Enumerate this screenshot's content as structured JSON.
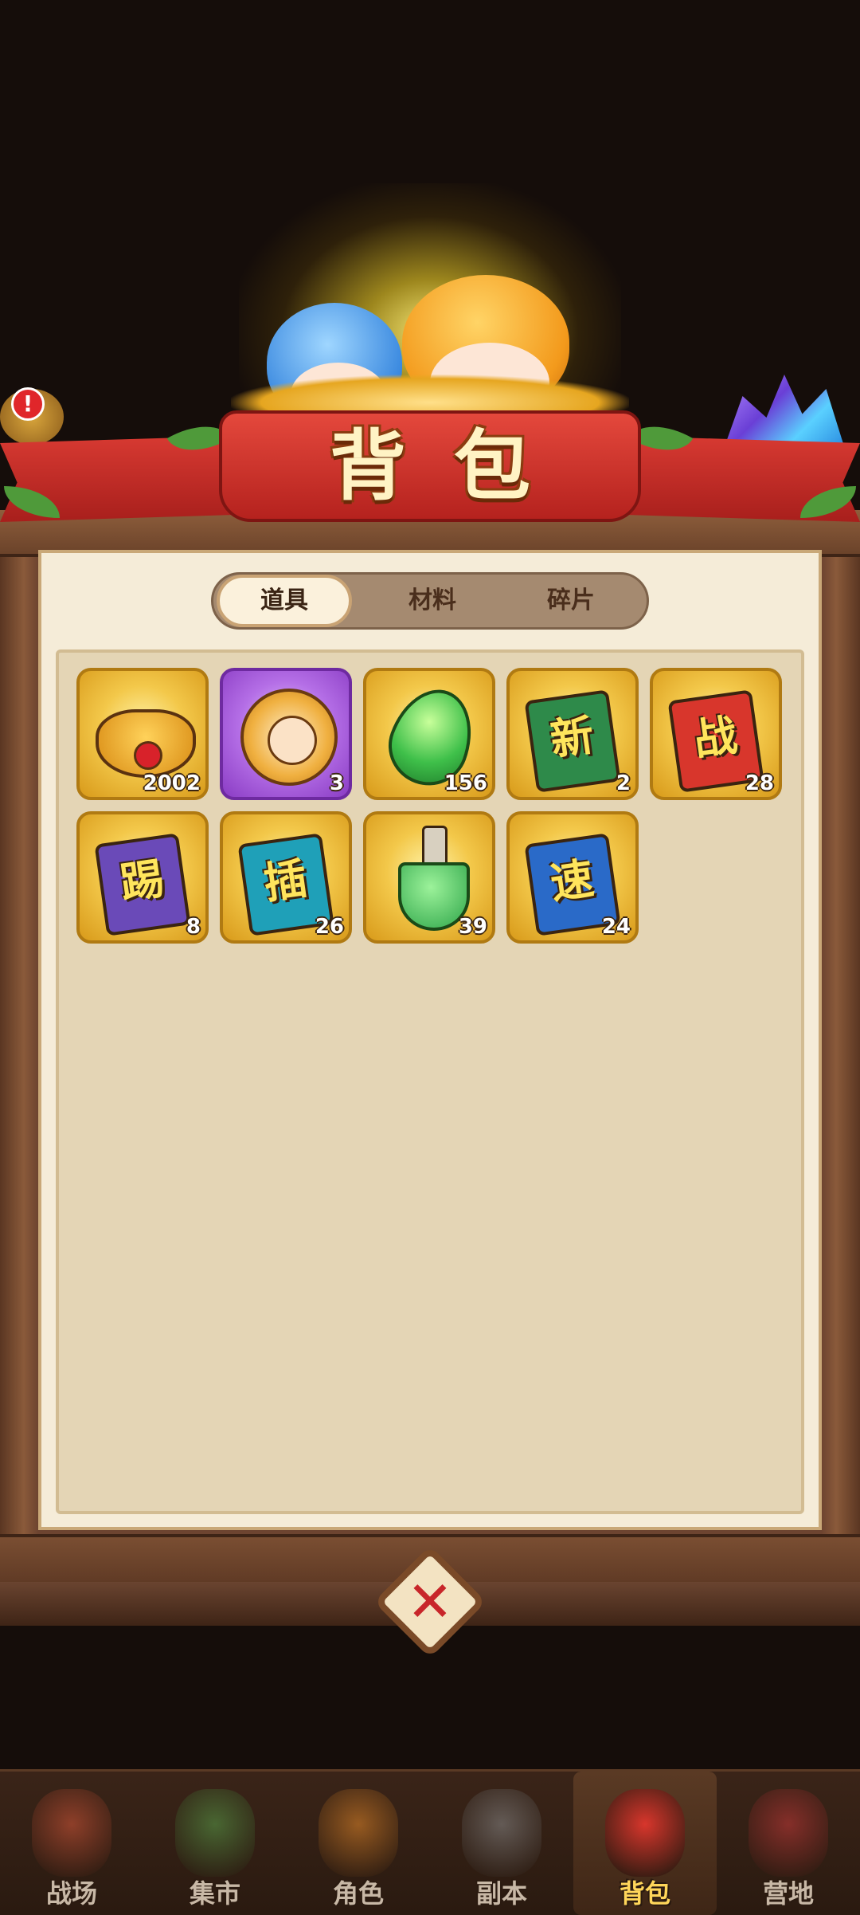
{
  "banner": {
    "title": "背包"
  },
  "alert_badge": "!",
  "tabs": [
    {
      "label": "道具",
      "active": true
    },
    {
      "label": "材料",
      "active": false
    },
    {
      "label": "碎片",
      "active": false
    }
  ],
  "items": [
    {
      "icon": "treasure-pot-icon",
      "count": "2002",
      "rarity": "gold"
    },
    {
      "icon": "character-coin-icon",
      "count": "3",
      "rarity": "purple"
    },
    {
      "icon": "leaf-gem-icon",
      "count": "156",
      "rarity": "gold"
    },
    {
      "icon": "skill-book-icon",
      "glyph": "新",
      "book_color": "#2e8a4a",
      "count": "2",
      "rarity": "gold"
    },
    {
      "icon": "skill-book-icon",
      "glyph": "战",
      "book_color": "#d8362c",
      "count": "28",
      "rarity": "gold"
    },
    {
      "icon": "skill-book-icon",
      "glyph": "踢",
      "book_color": "#6a4ab8",
      "count": "8",
      "rarity": "gold"
    },
    {
      "icon": "skill-book-icon",
      "glyph": "插",
      "book_color": "#1fa0b8",
      "count": "26",
      "rarity": "gold"
    },
    {
      "icon": "shovel-icon",
      "count": "39",
      "rarity": "gold"
    },
    {
      "icon": "skill-book-icon",
      "glyph": "速",
      "book_color": "#2a6ac8",
      "count": "24",
      "rarity": "gold"
    }
  ],
  "close_button": {
    "label": "✕"
  },
  "bottom_nav": [
    {
      "label": "战场",
      "icon": "battlefield-icon",
      "active": false,
      "color": "#d8583a"
    },
    {
      "label": "集市",
      "icon": "market-icon",
      "active": false,
      "color": "#5aa04a"
    },
    {
      "label": "角色",
      "icon": "character-icon",
      "active": false,
      "color": "#e88a2a"
    },
    {
      "label": "副本",
      "icon": "dungeon-icon",
      "active": false,
      "color": "#8a8a8a"
    },
    {
      "label": "背包",
      "icon": "backpack-icon",
      "active": true,
      "color": "#d8362c"
    },
    {
      "label": "营地",
      "icon": "camp-icon",
      "active": false,
      "color": "#c83a3a"
    }
  ]
}
